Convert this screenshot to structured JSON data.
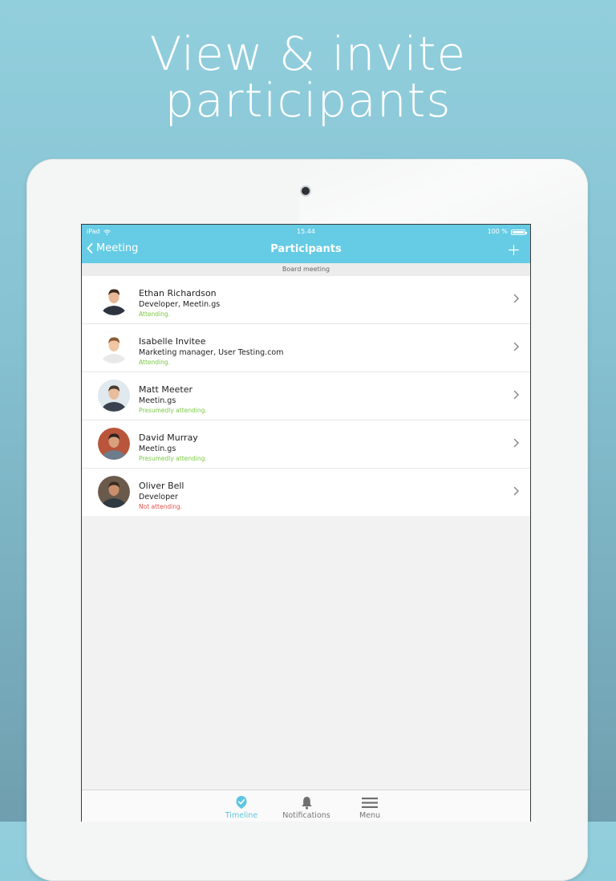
{
  "headline": {
    "line1": "View & invite",
    "line2": "participants"
  },
  "statusbar": {
    "device": "iPad",
    "time": "15.44",
    "battery": "100 %"
  },
  "navbar": {
    "back_label": "Meeting",
    "title": "Participants"
  },
  "section": {
    "title": "Board meeting"
  },
  "participants": [
    {
      "name": "Ethan Richardson",
      "role": "Developer, Meetin.gs",
      "status": "Attending.",
      "status_color": "#7ac943",
      "ring": "#7ac943"
    },
    {
      "name": "Isabelle Invitee",
      "role": "Marketing manager, User Testing.com",
      "status": "Attending.",
      "status_color": "#7ac943",
      "ring": "#7ac943"
    },
    {
      "name": "Matt Meeter",
      "role": "Meetin.gs",
      "status": "Presumedly attending.",
      "status_color": "#7ac943",
      "ring": "#7ac943"
    },
    {
      "name": "David Murray",
      "role": "Meetin.gs",
      "status": "Presumedly attending.",
      "status_color": "#7ac943",
      "ring": "#7ac943"
    },
    {
      "name": "Oliver Bell",
      "role": "Developer",
      "status": "Not attending.",
      "status_color": "#e0514a",
      "ring": "#e0514a"
    }
  ],
  "tabs": [
    {
      "label": "Timeline",
      "icon": "timeline-icon",
      "active": true
    },
    {
      "label": "Notifications",
      "icon": "bell-icon",
      "active": false
    },
    {
      "label": "Menu",
      "icon": "menu-icon",
      "active": false
    }
  ],
  "colors": {
    "accent": "#66cbe4",
    "active_tab": "#5cc6e0",
    "attending": "#7ac943",
    "not_attending": "#e0514a"
  }
}
